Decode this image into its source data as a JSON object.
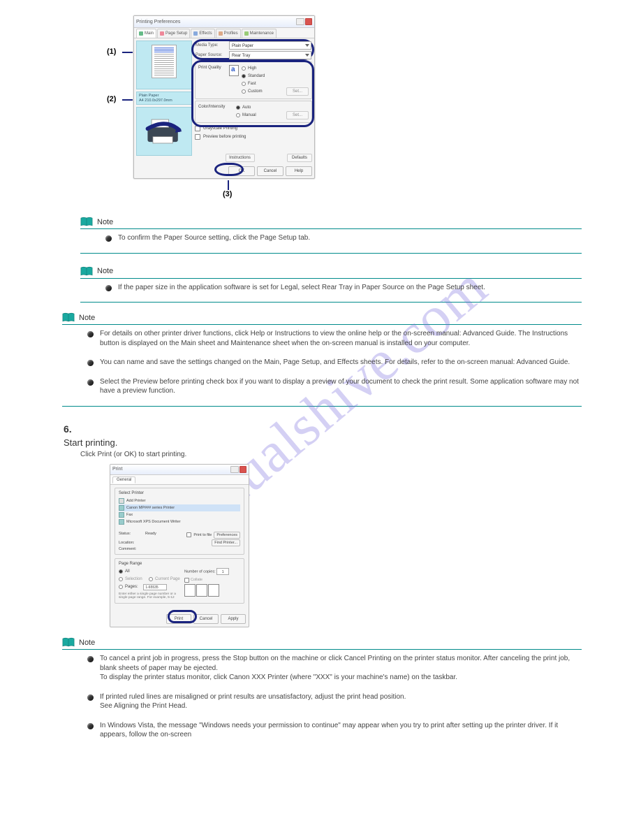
{
  "watermark": "manualshive.com",
  "labels": {
    "l1": "(1)",
    "l2": "(2)",
    "l3": "(3)"
  },
  "dlg1": {
    "title": "Printing Preferences",
    "tabs": [
      "Main",
      "Page Setup",
      "Effects",
      "Profiles",
      "Maintenance"
    ],
    "mediaTypeLabel": "Media Type:",
    "mediaTypeValue": "Plain Paper",
    "paperSourceLabel": "Paper Source:",
    "paperSourceValue": "Rear Tray",
    "printQualityLabel": "Print Quality",
    "pq": {
      "high": "High",
      "standard": "Standard",
      "fast": "Fast",
      "custom": "Custom"
    },
    "colorLabel": "Color/Intensity",
    "ci": {
      "auto": "Auto",
      "manual": "Manual"
    },
    "setBtn": "Set...",
    "grayscale": "Grayscale Printing",
    "preview": "Preview before printing",
    "paperName": "Plain Paper",
    "paperSize": "A4 210.0x297.0mm",
    "instructions": "Instructions",
    "defaults": "Defaults",
    "ok": "OK",
    "cancel": "Cancel",
    "help": "Help"
  },
  "notes": {
    "noteWord": "Note",
    "n1": "To confirm the Paper Source setting, click the Page Setup tab.",
    "n2": "If the paper size in the application software is set for Legal, select Rear Tray in Paper Source on the Page Setup sheet.",
    "n3a": "For details on other printer driver functions, click Help or Instructions to view the online help or the on-screen manual: Advanced Guide. The Instructions button is displayed on the Main sheet and Maintenance sheet when the on-screen manual is installed on your computer.",
    "n3b": "You can name and save the settings changed on the Main, Page Setup, and Effects sheets. For details, refer to the on-screen manual: Advanced Guide.",
    "n3c": "Select the Preview before printing check box if you want to display a preview of your document to check the print result. Some application software may not have a preview function."
  },
  "step": {
    "num": "6.",
    "title": "Start printing.",
    "sub": "Click Print (or OK) to start printing."
  },
  "dlg2": {
    "title": "Print",
    "tab": "General",
    "selectPrinter": "Select Printer",
    "printers": [
      "Add Printer",
      "Canon MP### series Printer",
      "Fax",
      "Microsoft XPS Document Writer"
    ],
    "statusLbl": "Status:",
    "statusVal": "Ready",
    "locationLbl": "Location:",
    "commentLbl": "Comment:",
    "printToFile": "Print to file",
    "preferences": "Preferences",
    "findPrinter": "Find Printer...",
    "pageRange": "Page Range",
    "all": "All",
    "selection": "Selection",
    "currentPage": "Current Page",
    "pages": "Pages:",
    "pagesVal": "1-65535",
    "pagesHint": "Enter either a single page number or a single page range. For example, 5-12",
    "copiesLbl": "Number of copies:",
    "copiesVal": "1",
    "collate": "Collate",
    "print": "Print",
    "cancel": "Cancel",
    "apply": "Apply"
  },
  "notes2": {
    "b1": "To cancel a print job in progress, press the Stop button on the machine or click Cancel Printing on the printer status monitor. After canceling the print job, blank sheets of paper may be ejected.",
    "b1b": "To display the printer status monitor, click Canon XXX Printer (where \"XXX\" is your machine's name) on the taskbar.",
    "b2": "If printed ruled lines are misaligned or print results are unsatisfactory, adjust the print head position.",
    "b2ref": "See Aligning the Print Head.",
    "b3": "In Windows Vista, the message \"Windows needs your permission to continue\" may appear when you try to print after setting up the printer driver. If it appears, follow the on-screen"
  }
}
